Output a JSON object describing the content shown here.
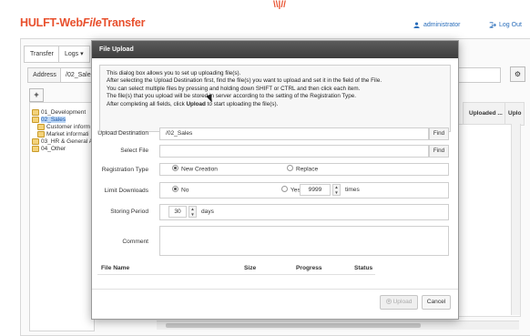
{
  "header": {
    "logo_prefix": "HULFT-Web",
    "logo_mid": "File",
    "logo_suffix": "Transfer",
    "user": "administrator",
    "logout": "Log Out",
    "top_mark": "\\\\|//"
  },
  "background": {
    "tabs": [
      "Transfer",
      "Logs ▾"
    ],
    "address_label": "Address",
    "address_value": "/02_Sales",
    "add_button": "+",
    "tree": [
      {
        "label": "01_Development",
        "level": 0,
        "selected": false
      },
      {
        "label": "02_Sales",
        "level": 0,
        "selected": true
      },
      {
        "label": "Customer inform",
        "level": 1,
        "selected": false
      },
      {
        "label": "Market informati",
        "level": 1,
        "selected": false
      },
      {
        "label": "03_HR & General A",
        "level": 0,
        "selected": false
      },
      {
        "label": "04_Other",
        "level": 0,
        "selected": false
      }
    ],
    "columns": [
      "Uploaded ...",
      "Uplo"
    ]
  },
  "dialog": {
    "title": "File Upload",
    "info_lines": [
      "This dialog box allows you to set up uploading file(s).",
      "After selecting the Upload Destination first, find the file(s) you want to upload and set it in the field of the File.",
      "You can select multiple files by pressing and holding down SHIFT or CTRL and then click each item.",
      "The file(s) that you upload will be stored in server according to the setting of the Registration Type.",
      "After completing all fields, click ",
      "Upload",
      " to start uploading the file(s)."
    ],
    "labels": {
      "destination": "Upload Destination",
      "select_file": "Select File",
      "registration": "Registration Type",
      "limit": "Limit Downloads",
      "storing": "Storing Period",
      "comment": "Comment"
    },
    "destination_value": "/02_Sales",
    "find_label": "Find",
    "registration_options": [
      "New Creation",
      "Replace"
    ],
    "limit_options": [
      "No",
      "Yes"
    ],
    "limit_value": "9999",
    "limit_unit": "times",
    "storing_value": "30",
    "storing_unit": "days",
    "table_headers": [
      "File Name",
      "Size",
      "Progress",
      "Status"
    ],
    "upload_button": "Upload",
    "cancel_button": "Cancel"
  },
  "colors": {
    "brand": "#e8502d",
    "link": "#2a6ebb",
    "title_bar": "#4a4a4a"
  }
}
